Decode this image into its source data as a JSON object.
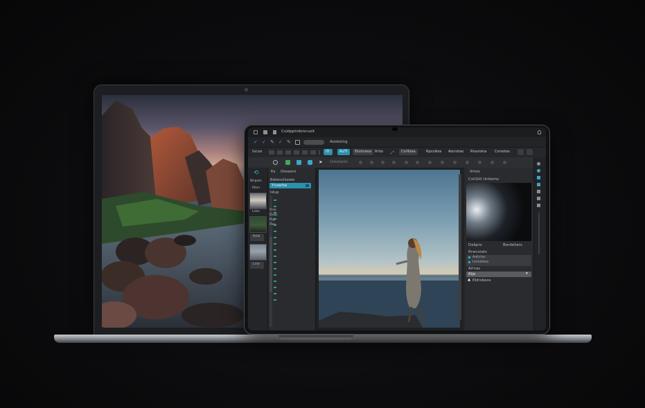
{
  "colors": {
    "accent": "#2a90ad",
    "panel": "#2a2b2e",
    "teal_icon": "#3aa7c8",
    "green_icon": "#4aa35a"
  },
  "app": {
    "title": "Cuidpptrdonnuoit",
    "toolbar1": {
      "tag_label": "Aoobxlng"
    },
    "toolbar2": {
      "left_label": "Iocse",
      "buttons": [
        "ID:",
        "AuTt",
        "Eksimaoa",
        "Rrtio",
        "Corlbiea",
        "Rpcolkos",
        "Aocrotao",
        "Riusroina",
        "Corsotos"
      ]
    },
    "toolbar3": {
      "label": "Uckotaiiic"
    },
    "rail": {
      "labels": [
        "Btrgsks",
        "Rbsn",
        "Lcbo",
        "Rrlel",
        "Lrivr"
      ]
    },
    "layers": {
      "tab_a": "Ks",
      "tab_b": "Oosaoni",
      "header": "Bsbeoutiuowe",
      "selected_layer": "Ycoerhe",
      "group_label": "Istup",
      "rows": [
        "Yrse",
        "Dxgs",
        "Prgr",
        "Piey"
      ]
    },
    "right_panel": {
      "title": "Ilrtsis",
      "subtitle": "Cxl/Gill Untiems",
      "left_caption": "Dxbprs",
      "right_caption": "Bordeliars",
      "section_label": "Rrwcoiats",
      "options": [
        "Aufcrtos",
        "Icsmdrbos"
      ],
      "field_label": "Arlnas",
      "select_value": "Rlje",
      "warning_label": "Ebtisbeos"
    }
  }
}
